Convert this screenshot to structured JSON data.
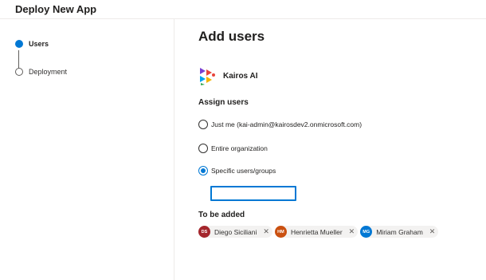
{
  "header": {
    "title": "Deploy New App"
  },
  "steps": [
    {
      "label": "Users",
      "state": "active"
    },
    {
      "label": "Deployment",
      "state": "inactive"
    }
  ],
  "main": {
    "title": "Add users",
    "app": {
      "name": "Kairos AI",
      "icon": "kairos-logo-icon"
    },
    "assign_label": "Assign users",
    "options": [
      {
        "label": "Just me (kai-admin@kairosdev2.onmicrosoft.com)",
        "checked": false
      },
      {
        "label": "Entire organization",
        "checked": false
      },
      {
        "label": "Specific users/groups",
        "checked": true
      }
    ],
    "search": {
      "value": "",
      "placeholder": ""
    },
    "to_be_added_label": "To be added",
    "users": [
      {
        "initials": "DS",
        "name": "Diego Siciliani",
        "color": "#a4262c"
      },
      {
        "initials": "HM",
        "name": "Henrietta Mueller",
        "color": "#ca5010"
      },
      {
        "initials": "MG",
        "name": "Miriam Graham",
        "color": "#0078d4"
      }
    ],
    "remove_glyph": "✕"
  },
  "colors": {
    "accent": "#0078d4",
    "divider": "#edebe9"
  }
}
